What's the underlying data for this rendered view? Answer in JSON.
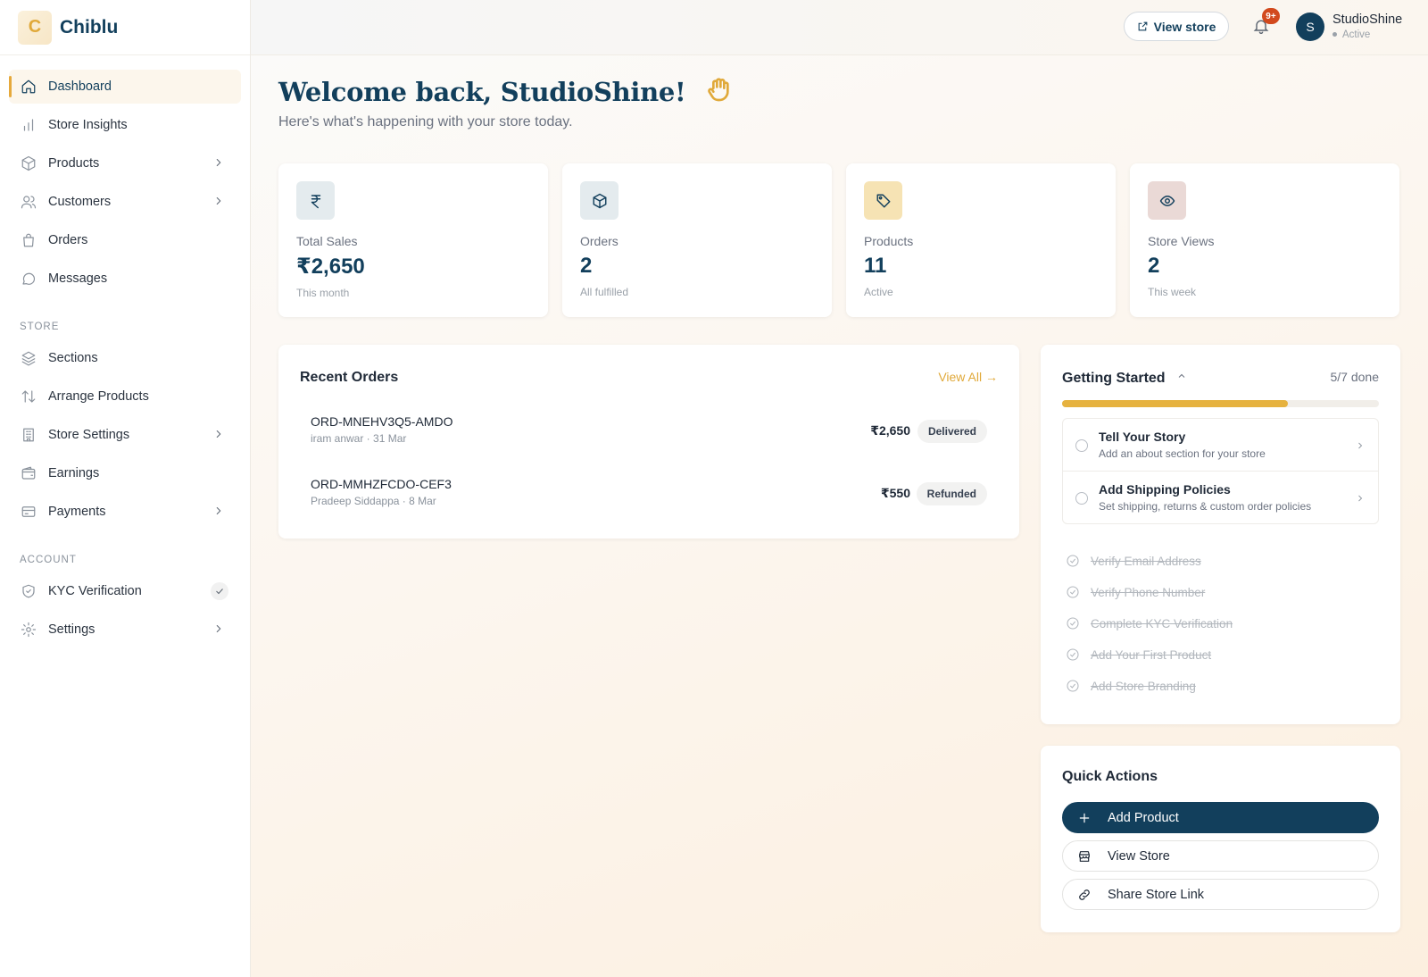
{
  "brand": {
    "logo_letter": "C",
    "name": "Chiblu"
  },
  "sidebar": {
    "items": [
      {
        "label": "Dashboard",
        "icon": "home-icon",
        "active": true
      },
      {
        "label": "Store Insights",
        "icon": "bar-chart-icon"
      },
      {
        "label": "Products",
        "icon": "box-icon",
        "chevron": true
      },
      {
        "label": "Customers",
        "icon": "users-icon",
        "chevron": true
      },
      {
        "label": "Orders",
        "icon": "shopping-bag-icon"
      },
      {
        "label": "Messages",
        "icon": "message-icon"
      }
    ],
    "store_label": "STORE",
    "store_items": [
      {
        "label": "Sections",
        "icon": "layers-icon"
      },
      {
        "label": "Arrange Products",
        "icon": "sort-arrows-icon"
      },
      {
        "label": "Store Settings",
        "icon": "building-icon",
        "chevron": true
      },
      {
        "label": "Earnings",
        "icon": "wallet-icon"
      },
      {
        "label": "Payments",
        "icon": "credit-card-icon",
        "chevron": true
      }
    ],
    "account_label": "ACCOUNT",
    "account_items": [
      {
        "label": "KYC Verification",
        "icon": "shield-icon",
        "verified": true
      },
      {
        "label": "Settings",
        "icon": "gear-icon",
        "chevron": true
      }
    ]
  },
  "topbar": {
    "view_store_label": "View store",
    "notification_badge": "9+",
    "avatar_letter": "S",
    "user_name": "StudioShine",
    "user_status": "Active"
  },
  "welcome": {
    "title": "Welcome back, StudioShine!",
    "subtitle": "Here's what's happening with your store today."
  },
  "stats": [
    {
      "label": "Total Sales",
      "value": "₹2,650",
      "sub": "This month",
      "icon": "rupee-icon",
      "color": "#e4ebee"
    },
    {
      "label": "Orders",
      "value": "2",
      "sub": "All fulfilled",
      "icon": "box-icon",
      "color": "#e4ebee"
    },
    {
      "label": "Products",
      "value": "11",
      "sub": "Active",
      "icon": "tag-icon",
      "color": "#f6e3b4"
    },
    {
      "label": "Store Views",
      "value": "2",
      "sub": "This week",
      "icon": "eye-icon",
      "color": "#ead9d6"
    }
  ],
  "recent_orders": {
    "title": "Recent Orders",
    "view_all": "View All →",
    "orders": [
      {
        "id": "ORD-MNEHV3Q5-AMDO",
        "meta": "iram anwar · 31 Mar",
        "amount": "₹2,650",
        "status": "Delivered"
      },
      {
        "id": "ORD-MMHZFCDO-CEF3",
        "meta": "Pradeep Siddappa · 8 Mar",
        "amount": "₹550",
        "status": "Refunded"
      }
    ]
  },
  "getting_started": {
    "title": "Getting Started",
    "done_label": "5/7 done",
    "progress_fraction": 0.714,
    "pending": [
      {
        "title": "Tell Your Story",
        "desc": "Add an about section for your store"
      },
      {
        "title": "Add Shipping Policies",
        "desc": "Set shipping, returns & custom order policies"
      }
    ],
    "completed": [
      "Verify Email Address",
      "Verify Phone Number",
      "Complete KYC Verification",
      "Add Your First Product",
      "Add Store Branding"
    ]
  },
  "quick_actions": {
    "title": "Quick Actions",
    "buttons": [
      {
        "label": "Add Product",
        "icon": "plus-icon",
        "primary": true
      },
      {
        "label": "View Store",
        "icon": "store-icon"
      },
      {
        "label": "Share Store Link",
        "icon": "link-icon"
      }
    ]
  }
}
